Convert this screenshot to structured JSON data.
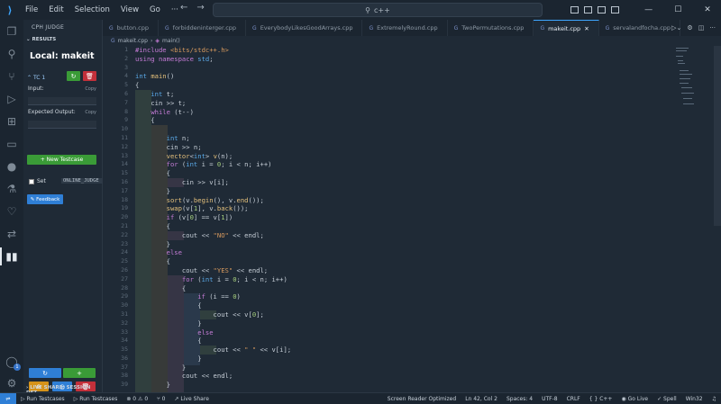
{
  "titlebar": {
    "menu": [
      "File",
      "Edit",
      "Selection",
      "View",
      "Go",
      "···"
    ],
    "search": "c++",
    "nav_back": "←",
    "nav_forward": "→"
  },
  "sidebar": {
    "title": "CPH JUDGE",
    "results": "RESULTS",
    "local": "Local: makeit",
    "tc_label": "TC 1",
    "input_label": "Input:",
    "expected_label": "Expected Output:",
    "copy": "Copy",
    "new_testcase": "+ New Testcase",
    "set_label": "Set",
    "online_judge": "ONLINE_JUDGE",
    "feedback": "Feedback",
    "live_share": "LIVE SHARE: SESSION DET..."
  },
  "tabs": [
    {
      "label": "button.cpp",
      "active": false
    },
    {
      "label": "forbiddeninterger.cpp",
      "active": false
    },
    {
      "label": "EverybodyLikesGoodArrays.cpp",
      "active": false
    },
    {
      "label": "ExtremelyRound.cpp",
      "active": false
    },
    {
      "label": "TwoPermutations.cpp",
      "active": false
    },
    {
      "label": "makeit.cpp",
      "active": true
    },
    {
      "label": "servalandfocha.cpp",
      "active": false
    }
  ],
  "breadcrumb": {
    "file": "makeit.cpp",
    "symbol": "main()"
  },
  "editor": {
    "line_numbers": [
      "1",
      "2",
      "3",
      "4",
      "5",
      "6",
      "7",
      "8",
      "9",
      "10",
      "11",
      "12",
      "13",
      "14",
      "15",
      "16",
      "17",
      "18",
      "19",
      "20",
      "21",
      "22",
      "23",
      "24",
      "25",
      "26",
      "27",
      "28",
      "29",
      "30",
      "31",
      "32",
      "33",
      "34",
      "35",
      "36",
      "37",
      "38",
      "39"
    ]
  },
  "status": {
    "run1": "Run Testcases",
    "run2": "Run Testcases",
    "problems": "⊗ 0 ⚠ 0",
    "ports": "⑂ 0",
    "liveshare": "Live Share",
    "screen_reader": "Screen Reader Optimized",
    "position": "Ln 42, Col 2",
    "spaces": "Spaces: 4",
    "encoding": "UTF-8",
    "eol": "CRLF",
    "language": "C++",
    "golive": "Go Live",
    "spell": "Spell",
    "platform": "Win32"
  }
}
